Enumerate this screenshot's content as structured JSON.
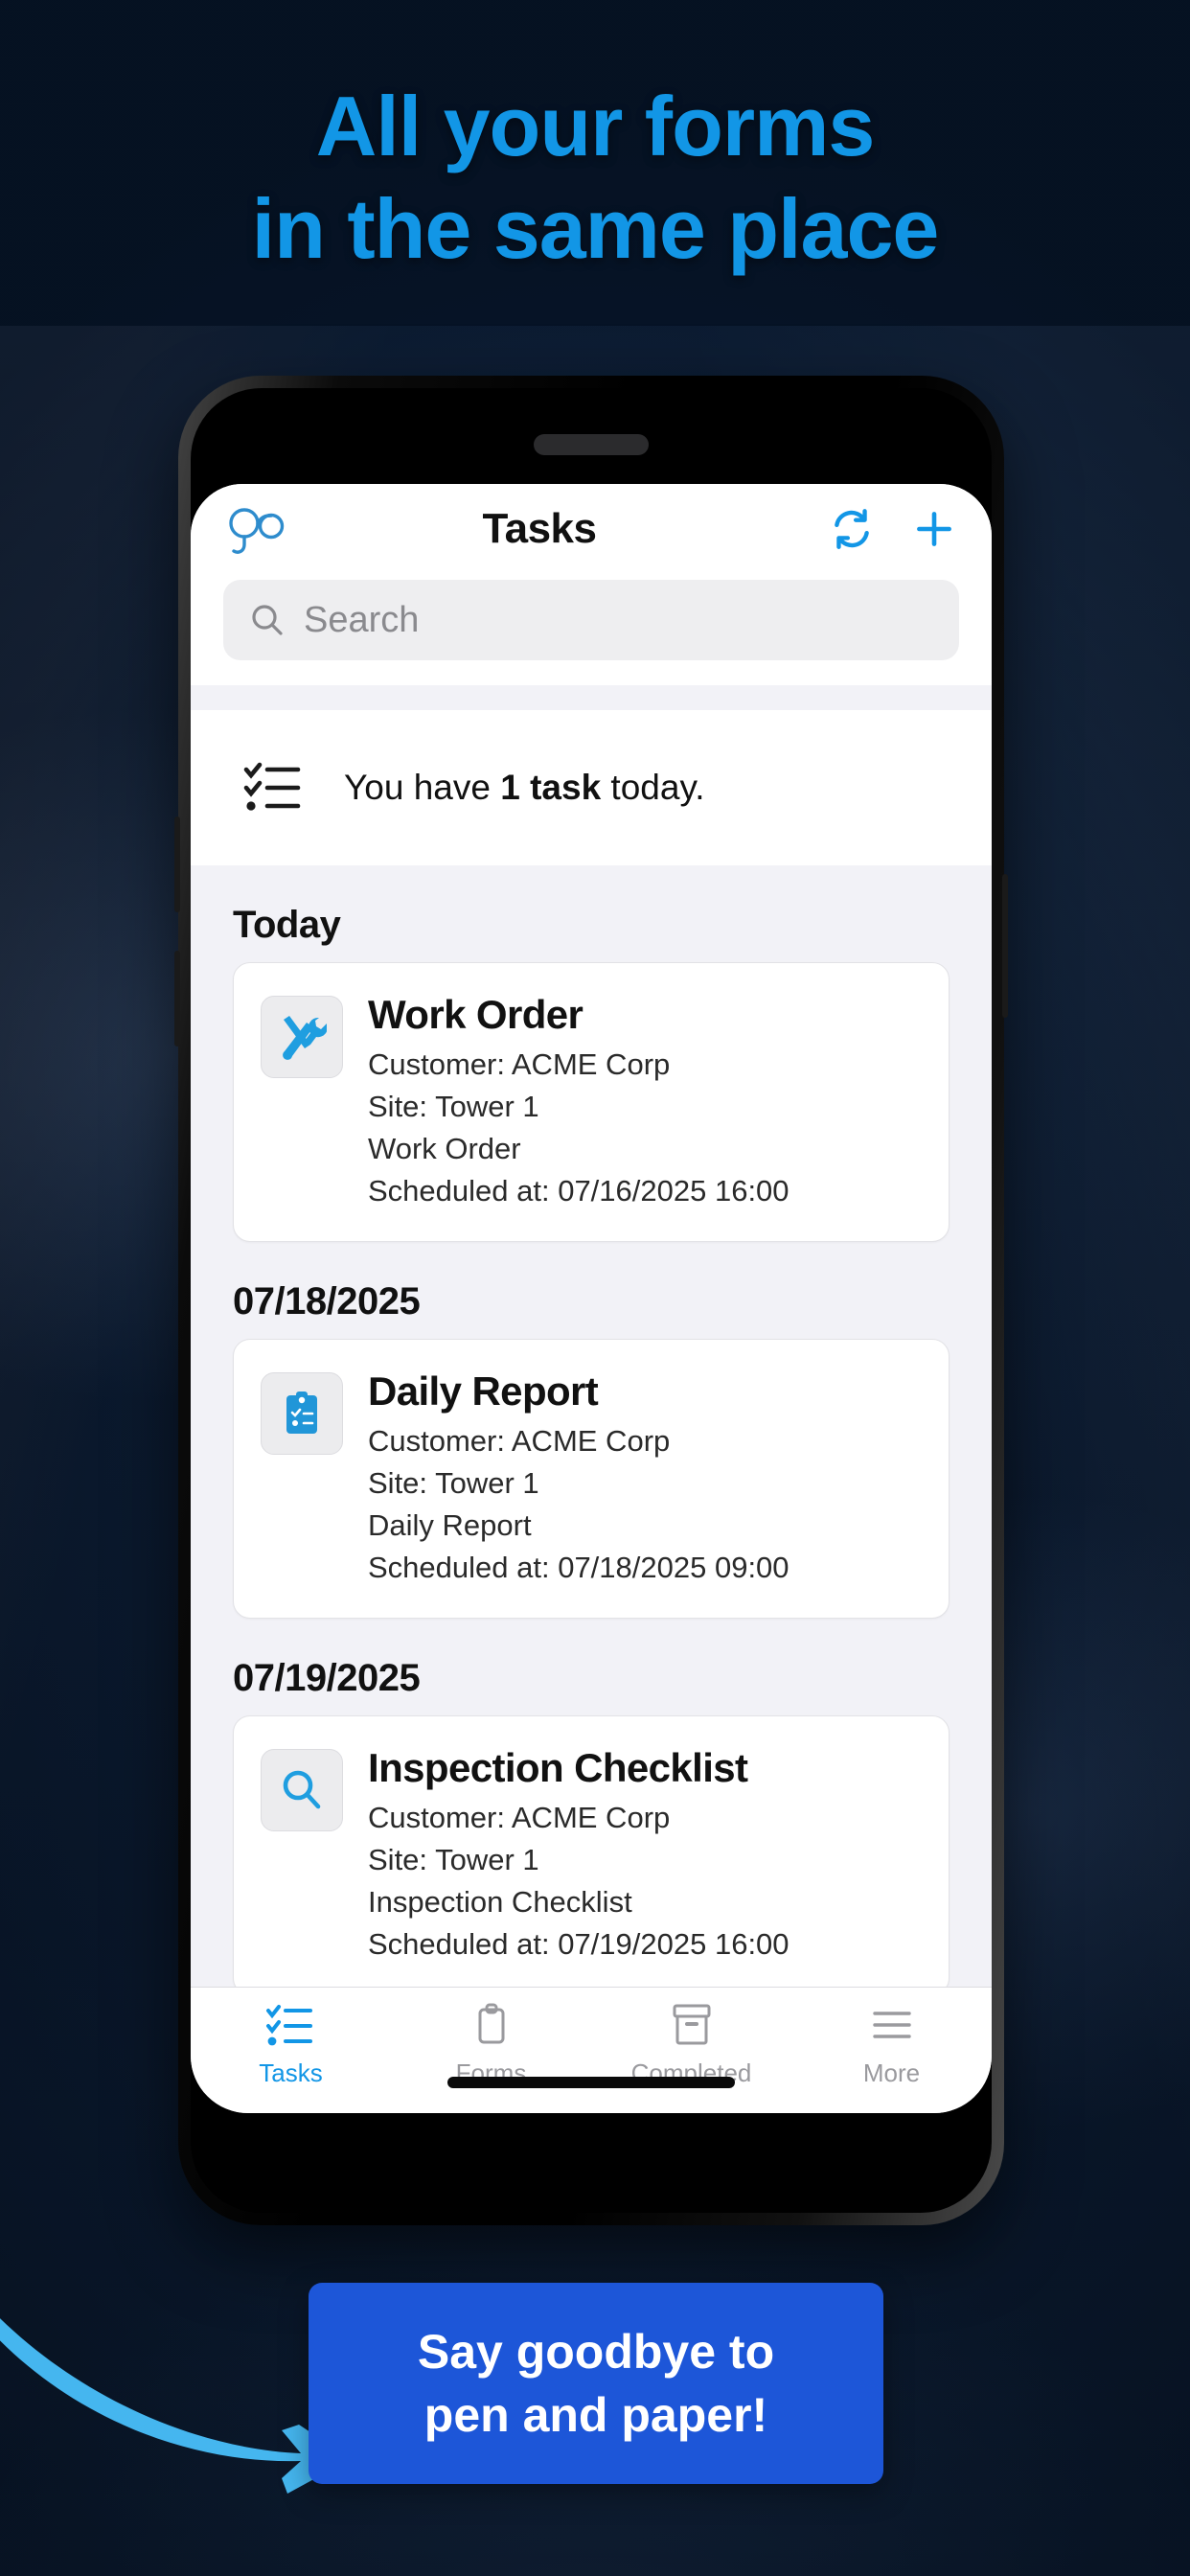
{
  "theme": {
    "bg_dark": "#07182f",
    "headline_blue": "#1296e6",
    "accent_blue": "#1296e6",
    "cta_blue": "#1d56d8",
    "arrow_blue": "#45b6ef"
  },
  "headline": {
    "line1": "All your forms",
    "line2": "in the same place"
  },
  "phone": {
    "navbar": {
      "logo_icon": "go-infinity-logo-icon",
      "title": "Tasks",
      "refresh_icon": "refresh-icon",
      "add_icon": "plus-icon"
    },
    "search": {
      "icon": "search-icon",
      "placeholder": "Search",
      "value": ""
    },
    "summary": {
      "icon": "checklist-icon",
      "prefix": "You have ",
      "highlight": "1 task",
      "suffix": " today."
    },
    "sections": [
      {
        "heading": "Today",
        "cards": [
          {
            "icon": "tools-icon",
            "title": "Work Order",
            "customer": "Customer: ACME Corp",
            "site": "Site: Tower 1",
            "form": "Work Order",
            "scheduled": "Scheduled at: 07/16/2025 16:00"
          }
        ]
      },
      {
        "heading": "07/18/2025",
        "cards": [
          {
            "icon": "clipboard-check-icon",
            "title": "Daily Report",
            "customer": "Customer: ACME Corp",
            "site": "Site: Tower 1",
            "form": "Daily Report",
            "scheduled": "Scheduled at: 07/18/2025 09:00"
          }
        ]
      },
      {
        "heading": "07/19/2025",
        "cards": [
          {
            "icon": "magnifier-icon",
            "title": "Inspection Checklist",
            "customer": "Customer: ACME Corp",
            "site": "Site: Tower 1",
            "form": "Inspection Checklist",
            "scheduled": "Scheduled at: 07/19/2025 16:00"
          }
        ]
      }
    ],
    "tabs": [
      {
        "label": "Tasks",
        "icon": "checklist-icon",
        "active": true
      },
      {
        "label": "Forms",
        "icon": "clipboard-icon",
        "active": false
      },
      {
        "label": "Completed",
        "icon": "archive-box-icon",
        "active": false
      },
      {
        "label": "More",
        "icon": "hamburger-menu-icon",
        "active": false
      }
    ]
  },
  "cta": {
    "line1": "Say goodbye to",
    "line2": "pen and paper!",
    "arrow_icon": "curved-arrow-right-icon"
  }
}
